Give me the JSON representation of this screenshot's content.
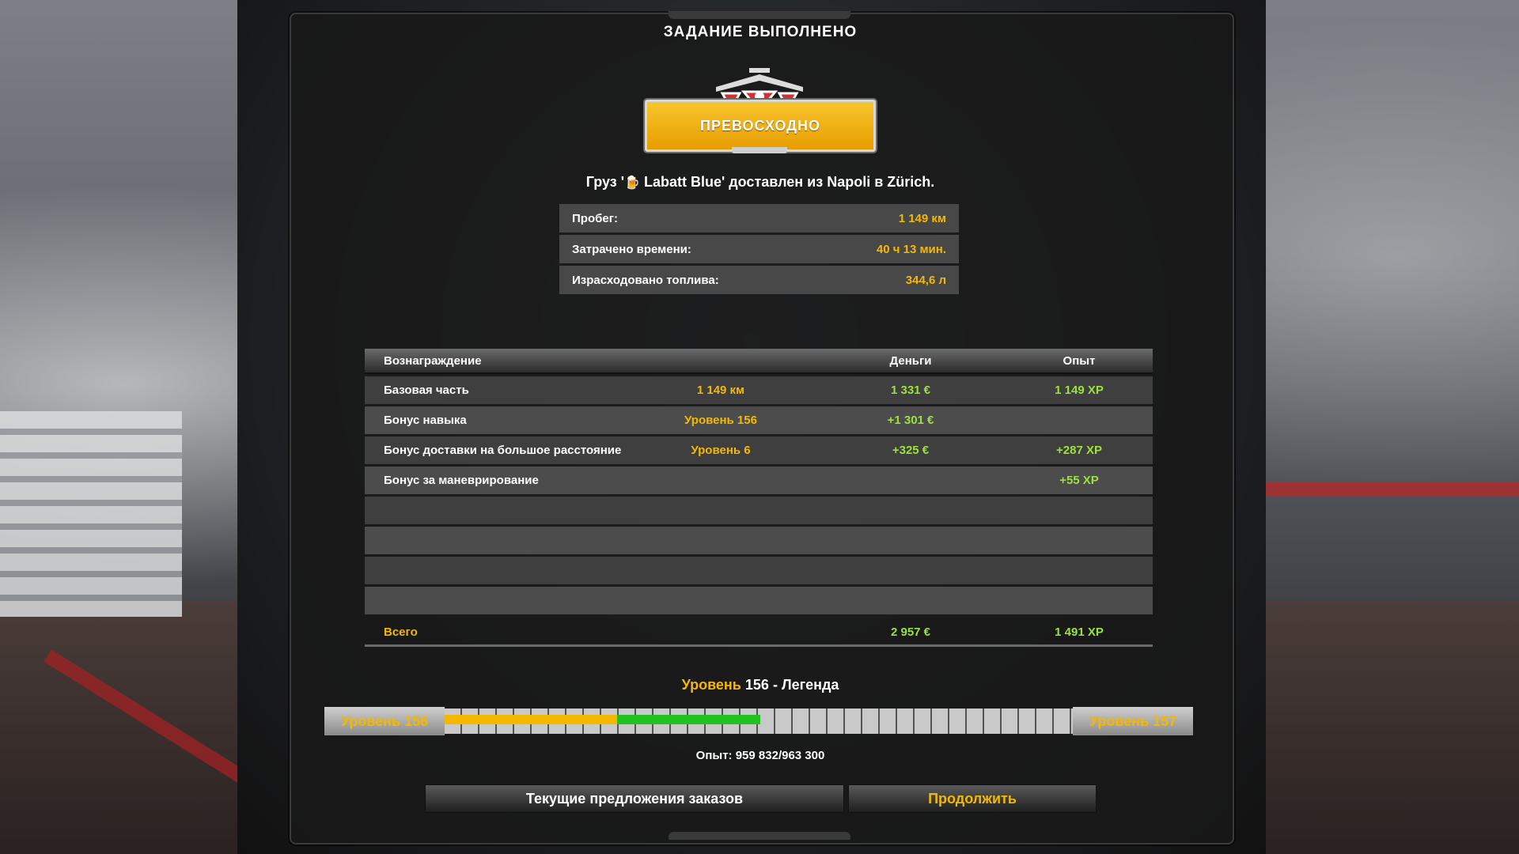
{
  "title": "ЗАДАНИЕ ВЫПОЛНЕНО",
  "rating": {
    "label": "ПРЕВОСХОДНО"
  },
  "cargo": {
    "prefix": "Груз '",
    "name": "Labatt Blue",
    "suffix": "' доставлен из Napoli в Zürich."
  },
  "stats": [
    {
      "label": "Пробег:",
      "value": "1 149 км"
    },
    {
      "label": "Затрачено времени:",
      "value": "40 ч 13 мин."
    },
    {
      "label": "Израсходовано топлива:",
      "value": "344,6 л"
    }
  ],
  "rewards": {
    "headers": {
      "name": "Вознаграждение",
      "money": "Деньги",
      "xp": "Опыт"
    },
    "rows": [
      {
        "name": "Базовая часть",
        "mid": "1 149 км",
        "money": "1 331 €",
        "xp": "1 149 XP"
      },
      {
        "name": "Бонус навыка",
        "mid": "Уровень 156",
        "money": "+1 301 €",
        "xp": ""
      },
      {
        "name": "Бонус доставки на большое расстояние",
        "mid": "Уровень 6",
        "money": "+325 €",
        "xp": "+287 XP"
      },
      {
        "name": "Бонус за маневрирование",
        "mid": "",
        "money": "",
        "xp": "+55 XP"
      }
    ],
    "total": {
      "name": "Всего",
      "money": "2 957 €",
      "xp": "1 491 XP"
    }
  },
  "level": {
    "label": "Уровень",
    "current": "156",
    "rank": "- Легенда",
    "bar_left": "Уровень 156",
    "bar_right": "Уровень 157",
    "previous_fraction": 0.274,
    "earned_fraction": 0.229,
    "colors": {
      "previous": "#f5b800",
      "earned": "#1fc21f"
    }
  },
  "experience": "Опыт: 959 832/963 300",
  "buttons": {
    "offers": "Текущие предложения заказов",
    "continue": "Продолжить"
  }
}
